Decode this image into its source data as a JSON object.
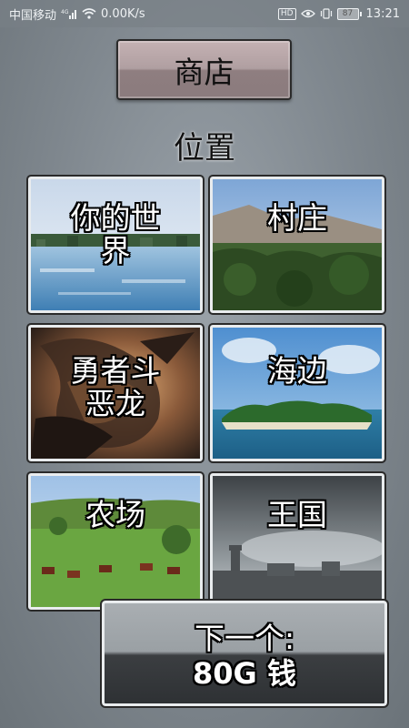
{
  "status_bar": {
    "carrier": "中国移动",
    "signal": "4G",
    "speed": "0.00K/s",
    "battery": "87",
    "time": "13:21"
  },
  "shop": {
    "label": "商店"
  },
  "section": {
    "title": "位置"
  },
  "locations": [
    {
      "label": "你的世\n界",
      "art": "lake-icon"
    },
    {
      "label": "村庄",
      "art": "village-icon"
    },
    {
      "label": "勇者斗\n恶龙",
      "art": "dragon-icon"
    },
    {
      "label": "海边",
      "art": "island-icon"
    },
    {
      "label": "农场",
      "art": "cows-icon"
    },
    {
      "label": "王国",
      "art": "castle-icon"
    }
  ],
  "next": {
    "line1": "下一个:",
    "line2": "80G 钱"
  },
  "colors": {
    "background": "#858d94",
    "tile_border": "#e9ecee",
    "shop_button": "#b09fa1"
  }
}
